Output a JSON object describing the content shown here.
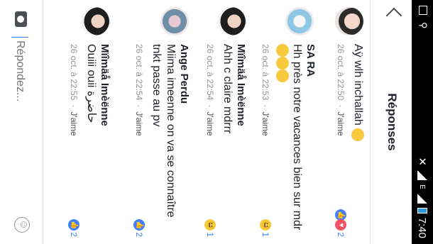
{
  "status": {
    "time": "7:40",
    "network": "E"
  },
  "header": {
    "title": "Réponses"
  },
  "comments": [
    {
      "name": "",
      "text": "Aÿ wlh inchallah",
      "time": "26 oct. à 22:50",
      "like": "J'aime",
      "count": "2",
      "reactions": [
        "like",
        "love"
      ]
    },
    {
      "name": "SA RA",
      "text": "Hh près notre vacances bien sur mdr",
      "time": "26 oct. à 22:53",
      "like": "J'aime",
      "count": "1",
      "reactions": [
        "haha"
      ]
    },
    {
      "name": "Mïîmäå Imèënne",
      "text": "Ahh c claire mdrrr",
      "time": "26 oct. à 22:54",
      "like": "J'aime",
      "count": "1",
      "reactions": [
        "haha"
      ]
    },
    {
      "name": "Ange Perdu",
      "text": "Miima imeenne on va se connaître tnkt passe au pv",
      "time": "26 oct. à 22:54",
      "like": "J'aime",
      "count": "2",
      "reactions": [
        "like"
      ]
    },
    {
      "name": "Mïîmäå Imèënne",
      "text": "Ouiii ouii حاضرة",
      "time": "26 oct. à 22:55",
      "like": "J'aime",
      "count": "2",
      "reactions": [
        "like"
      ]
    }
  ],
  "composer": {
    "placeholder": "Répondez..."
  }
}
